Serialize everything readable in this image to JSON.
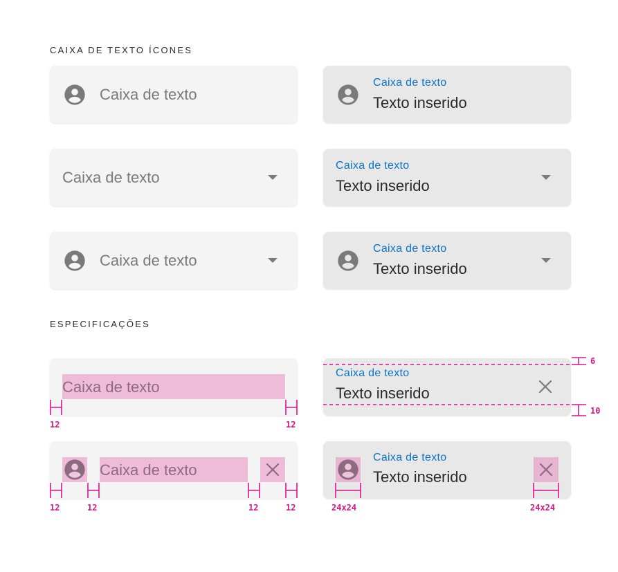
{
  "sections": {
    "icons_title": "CAIXA DE TEXTO ÍCONES",
    "specs_title": "ESPECIFICAÇÕES"
  },
  "field": {
    "placeholder": "Caixa de texto",
    "label": "Caixa de texto",
    "value": "Texto inserido"
  },
  "annotations": {
    "pad_12": "12",
    "top_6": "6",
    "bottom_10": "10",
    "size_24": "24x24"
  },
  "icons": [
    "account-circle-icon",
    "dropdown-caret-icon",
    "close-icon"
  ],
  "colors": {
    "label_blue": "#0a73c8",
    "spec_magenta": "#d6168a",
    "field_empty_bg": "#f4f4f4",
    "field_filled_bg": "#e8e8e8"
  }
}
